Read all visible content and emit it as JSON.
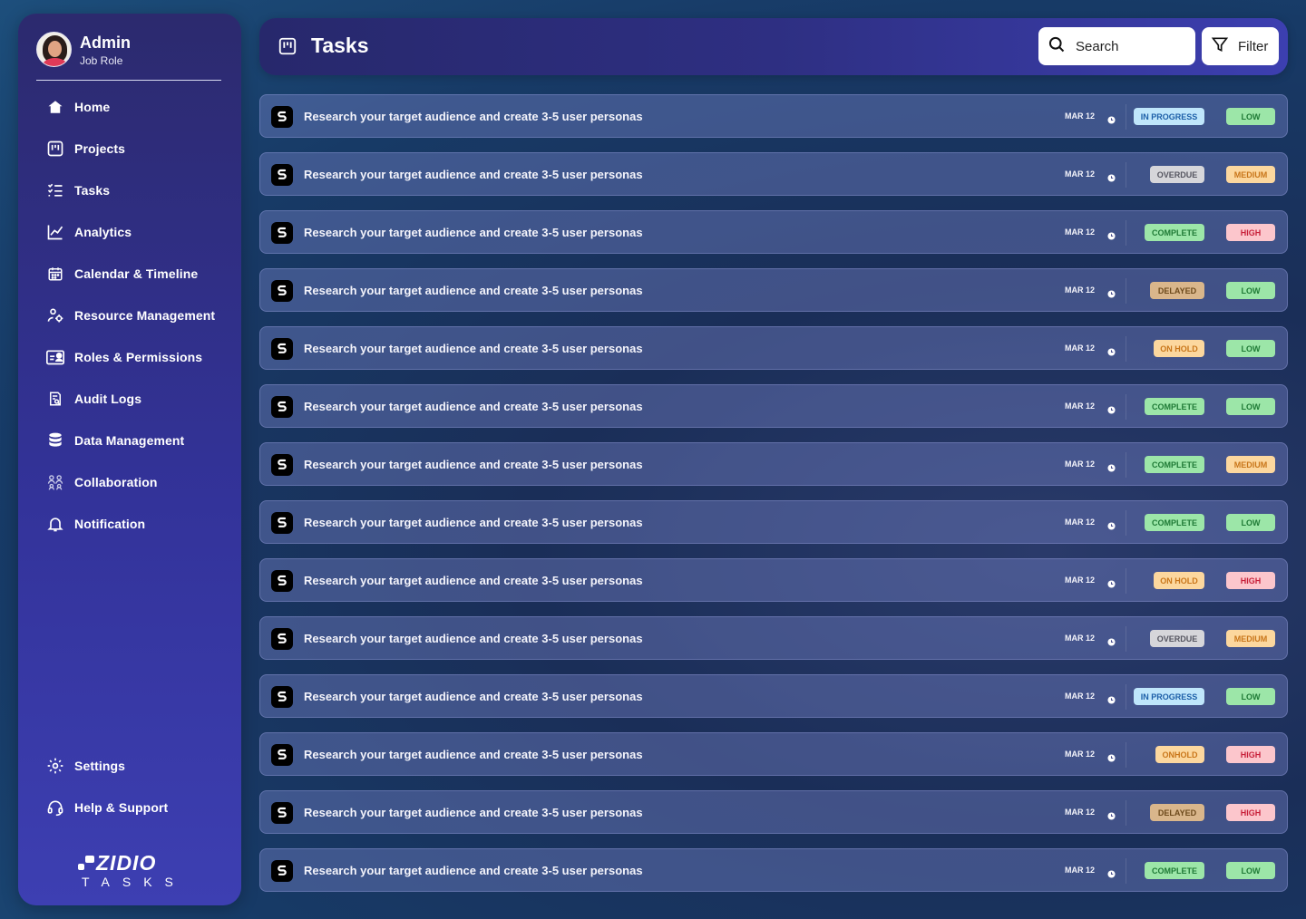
{
  "profile": {
    "name": "Admin",
    "role": "Job Role"
  },
  "nav": [
    {
      "label": "Home",
      "icon": "home-icon"
    },
    {
      "label": "Projects",
      "icon": "projects-icon"
    },
    {
      "label": "Tasks",
      "icon": "tasks-icon"
    },
    {
      "label": "Analytics",
      "icon": "analytics-icon"
    },
    {
      "label": "Calendar & Timeline",
      "icon": "calendar-icon"
    },
    {
      "label": "Resource Management",
      "icon": "resource-icon"
    },
    {
      "label": "Roles & Permissions",
      "icon": "roles-icon"
    },
    {
      "label": "Audit Logs",
      "icon": "audit-icon"
    },
    {
      "label": "Data Management",
      "icon": "database-icon"
    },
    {
      "label": "Collaboration",
      "icon": "collaboration-icon"
    },
    {
      "label": "Notification",
      "icon": "bell-icon"
    }
  ],
  "bottom_nav": [
    {
      "label": "Settings",
      "icon": "gear-icon"
    },
    {
      "label": "Help & Support",
      "icon": "headset-icon"
    }
  ],
  "logo": {
    "word": "ZIDIO",
    "sub": "TASKS"
  },
  "header": {
    "title": "Tasks",
    "search_label": "Search",
    "filter_label": "Filter"
  },
  "colors": {
    "in_progress": {
      "bg": "#bfe6fb",
      "fg": "#1d5fa8"
    },
    "overdue": {
      "bg": "#d6d6da",
      "fg": "#555560"
    },
    "complete": {
      "bg": "#9ce6a8",
      "fg": "#1f7a36"
    },
    "delayed": {
      "bg": "#d9b68b",
      "fg": "#6d4a1c"
    },
    "on_hold": {
      "bg": "#fcd79e",
      "fg": "#c9761a"
    },
    "low": {
      "bg": "#9ce6a8",
      "fg": "#1f7a36"
    },
    "medium": {
      "bg": "#fcd79e",
      "fg": "#c9761a"
    },
    "high": {
      "bg": "#fcc6cc",
      "fg": "#c8203a"
    }
  },
  "tasks": [
    {
      "title": "Research your target audience and create 3-5 user personas",
      "date": "MAR 12",
      "status": "IN PROGRESS",
      "status_key": "in_progress",
      "priority": "LOW",
      "priority_key": "low"
    },
    {
      "title": "Research your target audience and create 3-5 user personas",
      "date": "MAR 12",
      "status": "OVERDUE",
      "status_key": "overdue",
      "priority": "MEDIUM",
      "priority_key": "medium"
    },
    {
      "title": "Research your target audience and create 3-5 user personas",
      "date": "MAR 12",
      "status": "COMPLETE",
      "status_key": "complete",
      "priority": "HIGH",
      "priority_key": "high"
    },
    {
      "title": "Research your target audience and create 3-5 user personas",
      "date": "MAR 12",
      "status": "DELAYED",
      "status_key": "delayed",
      "priority": "LOW",
      "priority_key": "low"
    },
    {
      "title": "Research your target audience and create 3-5 user personas",
      "date": "MAR 12",
      "status": "ON HOLD",
      "status_key": "on_hold",
      "priority": "LOW",
      "priority_key": "low"
    },
    {
      "title": "Research your target audience and create 3-5 user personas",
      "date": "MAR 12",
      "status": "COMPLETE",
      "status_key": "complete",
      "priority": "LOW",
      "priority_key": "low"
    },
    {
      "title": "Research your target audience and create 3-5 user personas",
      "date": "MAR 12",
      "status": "COMPLETE",
      "status_key": "complete",
      "priority": "MEDIUM",
      "priority_key": "medium"
    },
    {
      "title": "Research your target audience and create 3-5 user personas",
      "date": "MAR 12",
      "status": "COMPLETE",
      "status_key": "complete",
      "priority": "LOW",
      "priority_key": "low"
    },
    {
      "title": "Research your target audience and create 3-5 user personas",
      "date": "MAR 12",
      "status": "ON HOLD",
      "status_key": "on_hold",
      "priority": "HIGH",
      "priority_key": "high"
    },
    {
      "title": "Research your target audience and create 3-5 user personas",
      "date": "MAR 12",
      "status": "OVERDUE",
      "status_key": "overdue",
      "priority": "MEDIUM",
      "priority_key": "medium"
    },
    {
      "title": "Research your target audience and create 3-5 user personas",
      "date": "MAR 12",
      "status": "IN PROGRESS",
      "status_key": "in_progress",
      "priority": "LOW",
      "priority_key": "low"
    },
    {
      "title": "Research your target audience and create 3-5 user personas",
      "date": "MAR 12",
      "status": "ONHOLD",
      "status_key": "on_hold",
      "priority": "HIGH",
      "priority_key": "high"
    },
    {
      "title": "Research your target audience and create 3-5 user personas",
      "date": "MAR 12",
      "status": "DELAYED",
      "status_key": "delayed",
      "priority": "HIGH",
      "priority_key": "high"
    },
    {
      "title": "Research your target audience and create 3-5 user personas",
      "date": "MAR 12",
      "status": "COMPLETE",
      "status_key": "complete",
      "priority": "LOW",
      "priority_key": "low"
    }
  ]
}
